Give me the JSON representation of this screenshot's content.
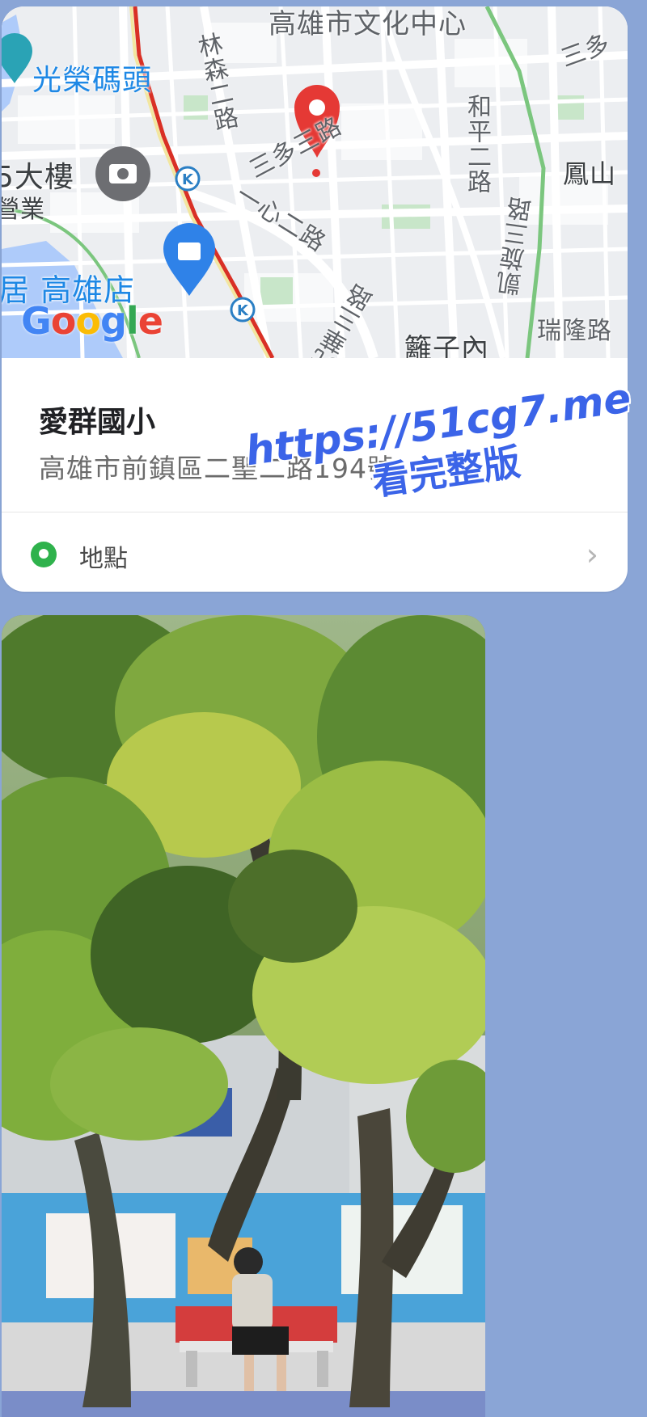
{
  "location_card": {
    "map": {
      "labels": {
        "cultural_center": "高雄市文化中心",
        "guangrong_pier": "光榮碼頭",
        "building": "5大樓",
        "business": "營業",
        "linsen": "林森二路",
        "sanduo": "三多三路",
        "yixin": "一心二路",
        "heping": "和平二路",
        "fengshan": "鳳山",
        "kaixuan": "凱旋三路",
        "store": "居 高雄店",
        "guanghua": "光華三路",
        "lizinei": "籬子內",
        "ruilong": "瑞隆路",
        "sanduo_corner": "三多"
      },
      "logo_letters": [
        "G",
        "o",
        "o",
        "g",
        "l",
        "e"
      ],
      "logo_colors": [
        "#4285F4",
        "#EA4335",
        "#FBBC05",
        "#4285F4",
        "#34A853",
        "#EA4335"
      ],
      "pin_color": "#e53935"
    },
    "place_name": "愛群國小",
    "place_address": "高雄市前鎮區二聖二路194號",
    "footer_label": "地點",
    "footer_icon": "location-pin-icon",
    "chevron": "›"
  },
  "watermark": {
    "line1": "https://51cg7.me",
    "line2": "看完整版"
  },
  "photo": {
    "description_icon": "photo-image"
  }
}
